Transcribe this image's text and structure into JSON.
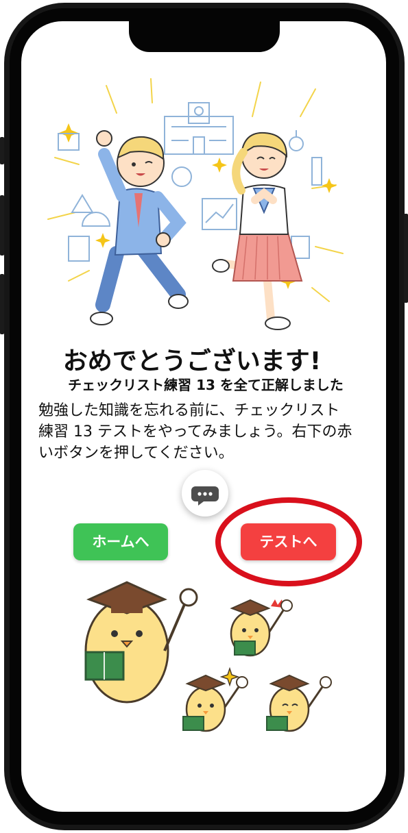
{
  "hero_illustration": "celebrating-students-illustration",
  "mascot_illustration": "graduation-chicks-illustration",
  "content": {
    "title": "おめでとうございます!",
    "subtitle": "チェックリスト練習 13 を全て正解しました",
    "body_lines": [
      "勉強した知識を忘れる前に、チェックリスト",
      "練習 13 テストをやってみましょう。右下の赤",
      "いボタンを押してください。"
    ]
  },
  "chat_button_icon": "chat-bubble-icon",
  "buttons": {
    "home_label": "ホームへ",
    "test_label": "テストへ"
  },
  "colors": {
    "home_button": "#3fc356",
    "test_button": "#f44040",
    "highlight_ellipse": "#d9101c"
  }
}
